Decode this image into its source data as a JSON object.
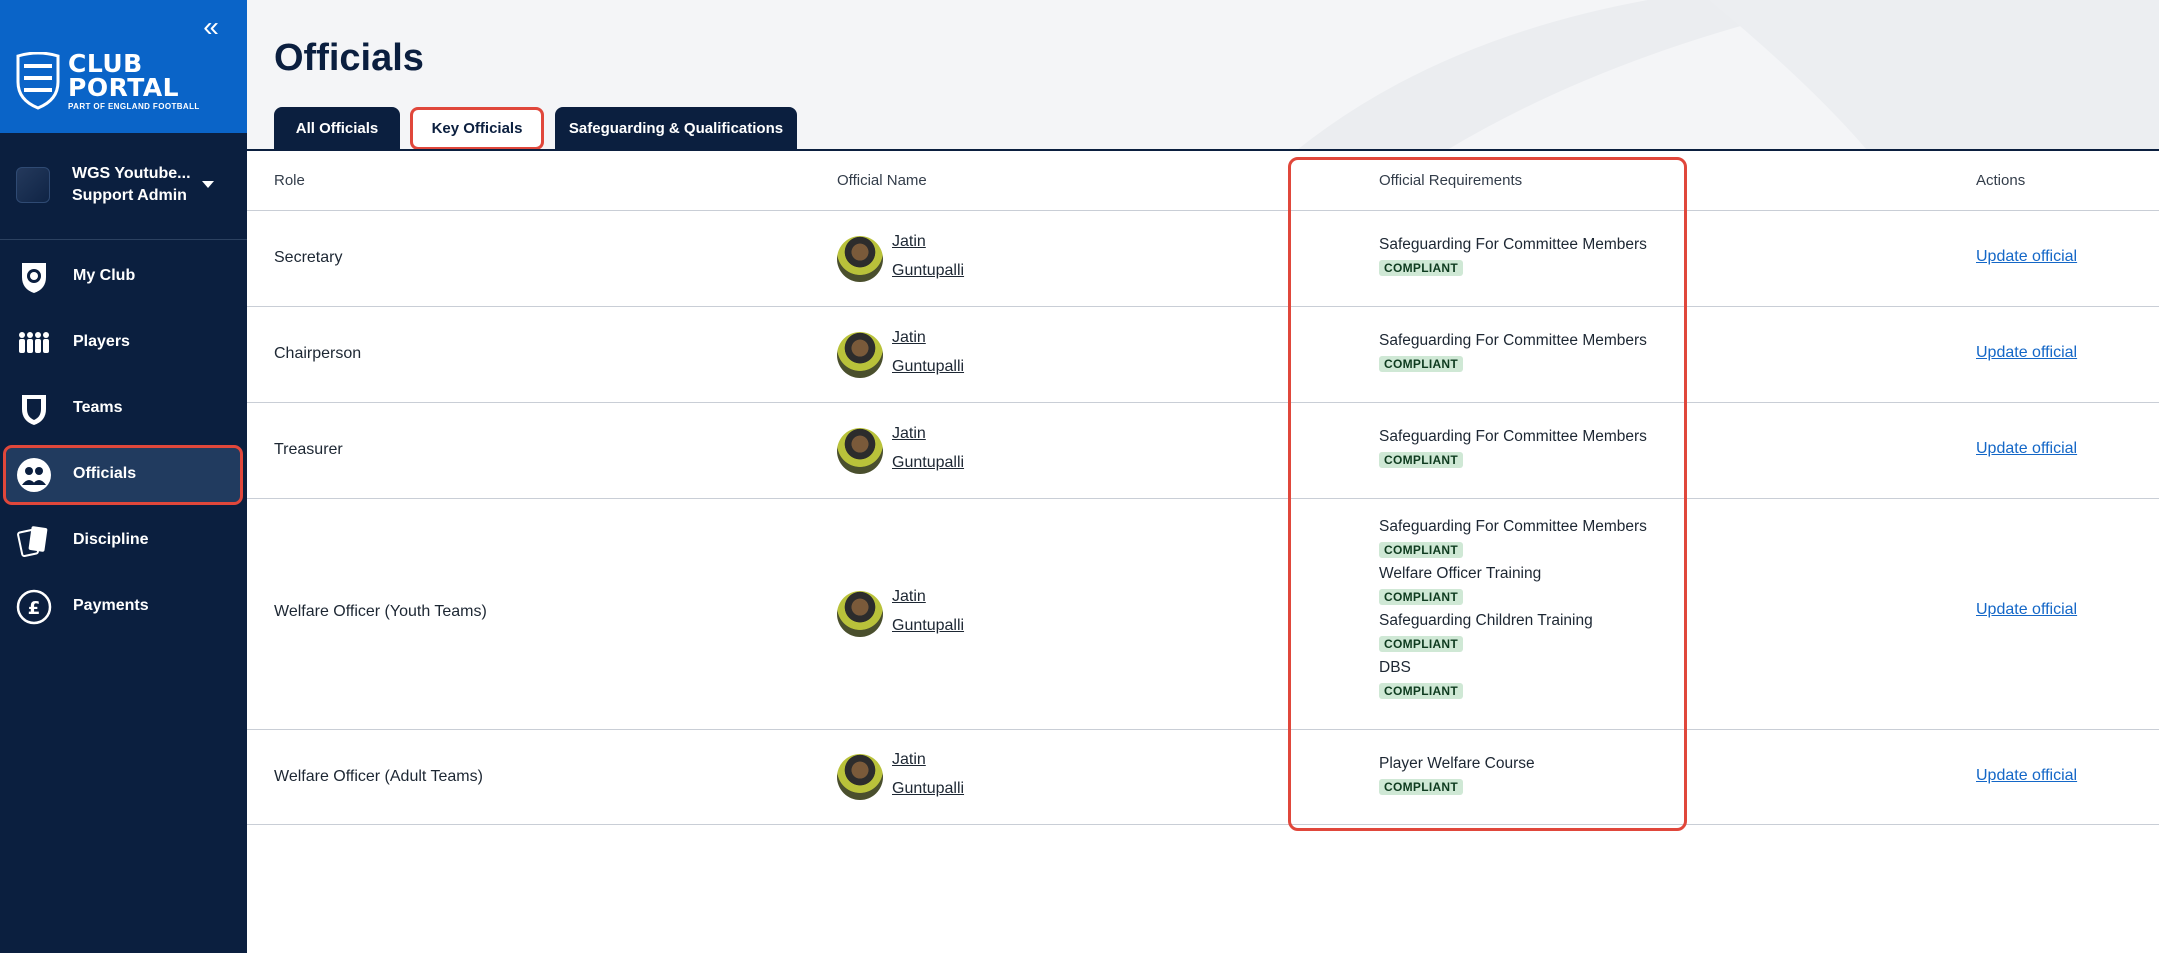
{
  "sidebar": {
    "brand": {
      "line1": "CLUB",
      "line2": "PORTAL",
      "sub": "PART OF ENGLAND FOOTBALL"
    },
    "club": {
      "name": "WGS Youtube...",
      "role": "Support Admin"
    },
    "nav": [
      {
        "label": "My Club",
        "icon": "shield-ball-icon"
      },
      {
        "label": "Players",
        "icon": "players-icon"
      },
      {
        "label": "Teams",
        "icon": "teams-shield-icon"
      },
      {
        "label": "Officials",
        "icon": "officials-icon",
        "active": true
      },
      {
        "label": "Discipline",
        "icon": "cards-icon"
      },
      {
        "label": "Payments",
        "icon": "pound-icon"
      }
    ]
  },
  "page": {
    "title": "Officials",
    "tabs": [
      {
        "label": "All Officials"
      },
      {
        "label": "Key Officials",
        "selected": true
      },
      {
        "label": "Safeguarding & Qualifications"
      }
    ]
  },
  "table": {
    "headers": {
      "role": "Role",
      "name": "Official Name",
      "requirements": "Official Requirements",
      "actions": "Actions"
    },
    "rows": [
      {
        "role": "Secretary",
        "first": "Jatin",
        "last": "Guntupalli",
        "requirements": [
          {
            "title": "Safeguarding For Committee Members",
            "status": "COMPLIANT"
          }
        ],
        "action": "Update official"
      },
      {
        "role": "Chairperson",
        "first": "Jatin",
        "last": "Guntupalli",
        "requirements": [
          {
            "title": "Safeguarding For Committee Members",
            "status": "COMPLIANT"
          }
        ],
        "action": "Update official"
      },
      {
        "role": "Treasurer",
        "first": "Jatin",
        "last": "Guntupalli",
        "requirements": [
          {
            "title": "Safeguarding For Committee Members",
            "status": "COMPLIANT"
          }
        ],
        "action": "Update official"
      },
      {
        "role": "Welfare Officer (Youth Teams)",
        "first": "Jatin",
        "last": "Guntupalli",
        "requirements": [
          {
            "title": "Safeguarding For Committee Members",
            "status": "COMPLIANT"
          },
          {
            "title": "Welfare Officer Training",
            "status": "COMPLIANT"
          },
          {
            "title": "Safeguarding Children Training",
            "status": "COMPLIANT"
          },
          {
            "title": "DBS",
            "status": "COMPLIANT"
          }
        ],
        "action": "Update official"
      },
      {
        "role": "Welfare Officer (Adult Teams)",
        "first": "Jatin",
        "last": "Guntupalli",
        "requirements": [
          {
            "title": "Player Welfare Course",
            "status": "COMPLIANT"
          }
        ],
        "action": "Update official"
      }
    ]
  },
  "colors": {
    "sidebar": "#0b1f3f",
    "brand": "#0a64c8",
    "highlight": "#e0473b",
    "badge_bg": "#cfe8d5",
    "link": "#1467c7"
  }
}
